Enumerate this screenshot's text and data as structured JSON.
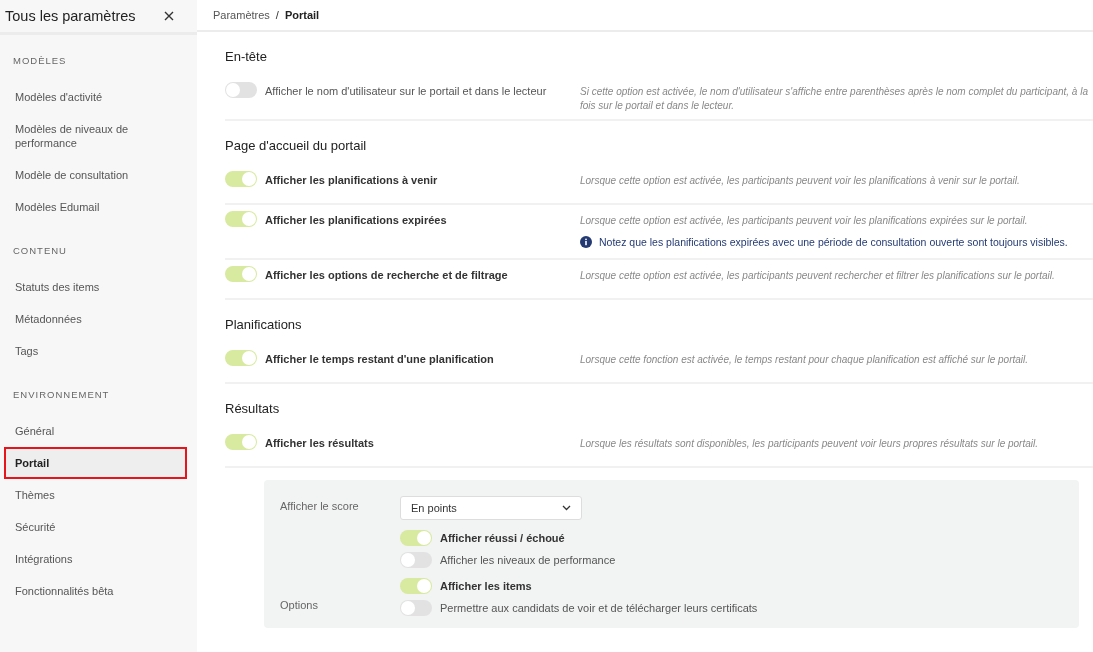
{
  "sidebar": {
    "title": "Tous les paramètres",
    "groups": [
      {
        "heading": "MODÈLES",
        "items": [
          {
            "label": "Modèles d'activité",
            "selected": false
          },
          {
            "label": "Modèles de niveaux de performance",
            "selected": false
          },
          {
            "label": "Modèle de consultation",
            "selected": false
          },
          {
            "label": "Modèles Edumail",
            "selected": false
          }
        ]
      },
      {
        "heading": "CONTENU",
        "items": [
          {
            "label": "Statuts des items",
            "selected": false
          },
          {
            "label": "Métadonnées",
            "selected": false
          },
          {
            "label": "Tags",
            "selected": false
          }
        ]
      },
      {
        "heading": "ENVIRONNEMENT",
        "items": [
          {
            "label": "Général",
            "selected": false
          },
          {
            "label": "Portail",
            "selected": true
          },
          {
            "label": "Thèmes",
            "selected": false
          },
          {
            "label": "Sécurité",
            "selected": false
          },
          {
            "label": "Intégrations",
            "selected": false
          },
          {
            "label": "Fonctionnalités bêta",
            "selected": false
          }
        ]
      }
    ]
  },
  "breadcrumb": {
    "items": [
      "Paramètres",
      "Portail"
    ],
    "separator": "/"
  },
  "sections": [
    {
      "title": "En-tête",
      "settings": [
        {
          "label": "Afficher le nom d'utilisateur sur le portail et dans le lecteur",
          "on": false,
          "description": "Si cette option est activée, le nom d'utilisateur s'affiche entre parenthèses après le nom complet du participant, à la fois sur le portail et dans le lecteur."
        }
      ]
    },
    {
      "title": "Page d'accueil du portail",
      "settings": [
        {
          "label": "Afficher les planifications à venir",
          "on": true,
          "description": "Lorsque cette option est activée, les participants peuvent voir les planifications à venir sur le portail."
        },
        {
          "label": "Afficher les planifications expirées",
          "on": true,
          "description": "Lorsque cette option est activée, les participants peuvent voir les planifications expirées sur le portail.",
          "note": "Notez que les planifications expirées avec une période de consultation ouverte sont toujours visibles."
        },
        {
          "label": "Afficher les options de recherche et de filtrage",
          "on": true,
          "description": "Lorsque cette option est activée, les participants peuvent rechercher et filtrer les planifications sur le portail."
        }
      ]
    },
    {
      "title": "Planifications",
      "settings": [
        {
          "label": "Afficher le temps restant d'une planification",
          "on": true,
          "description": "Lorsque cette fonction est activée, le temps restant pour chaque planification est affiché sur le portail."
        }
      ]
    },
    {
      "title": "Résultats",
      "settings": [
        {
          "label": "Afficher les résultats",
          "on": true,
          "description": "Lorsque les résultats sont disponibles, les participants peuvent voir leurs propres résultats sur le portail."
        }
      ],
      "panel": {
        "score": {
          "label": "Afficher le score",
          "value": "En points"
        },
        "groups": [
          {
            "toggles": [
              {
                "label": "Afficher réussi / échoué",
                "on": true
              },
              {
                "label": "Afficher les niveaux de performance",
                "on": false
              }
            ]
          },
          {
            "label": "Options",
            "toggles": [
              {
                "label": "Afficher les items",
                "on": true
              },
              {
                "label": "Permettre aux candidats de voir et de télécharger leurs certificats",
                "on": false
              }
            ]
          }
        ]
      }
    }
  ]
}
